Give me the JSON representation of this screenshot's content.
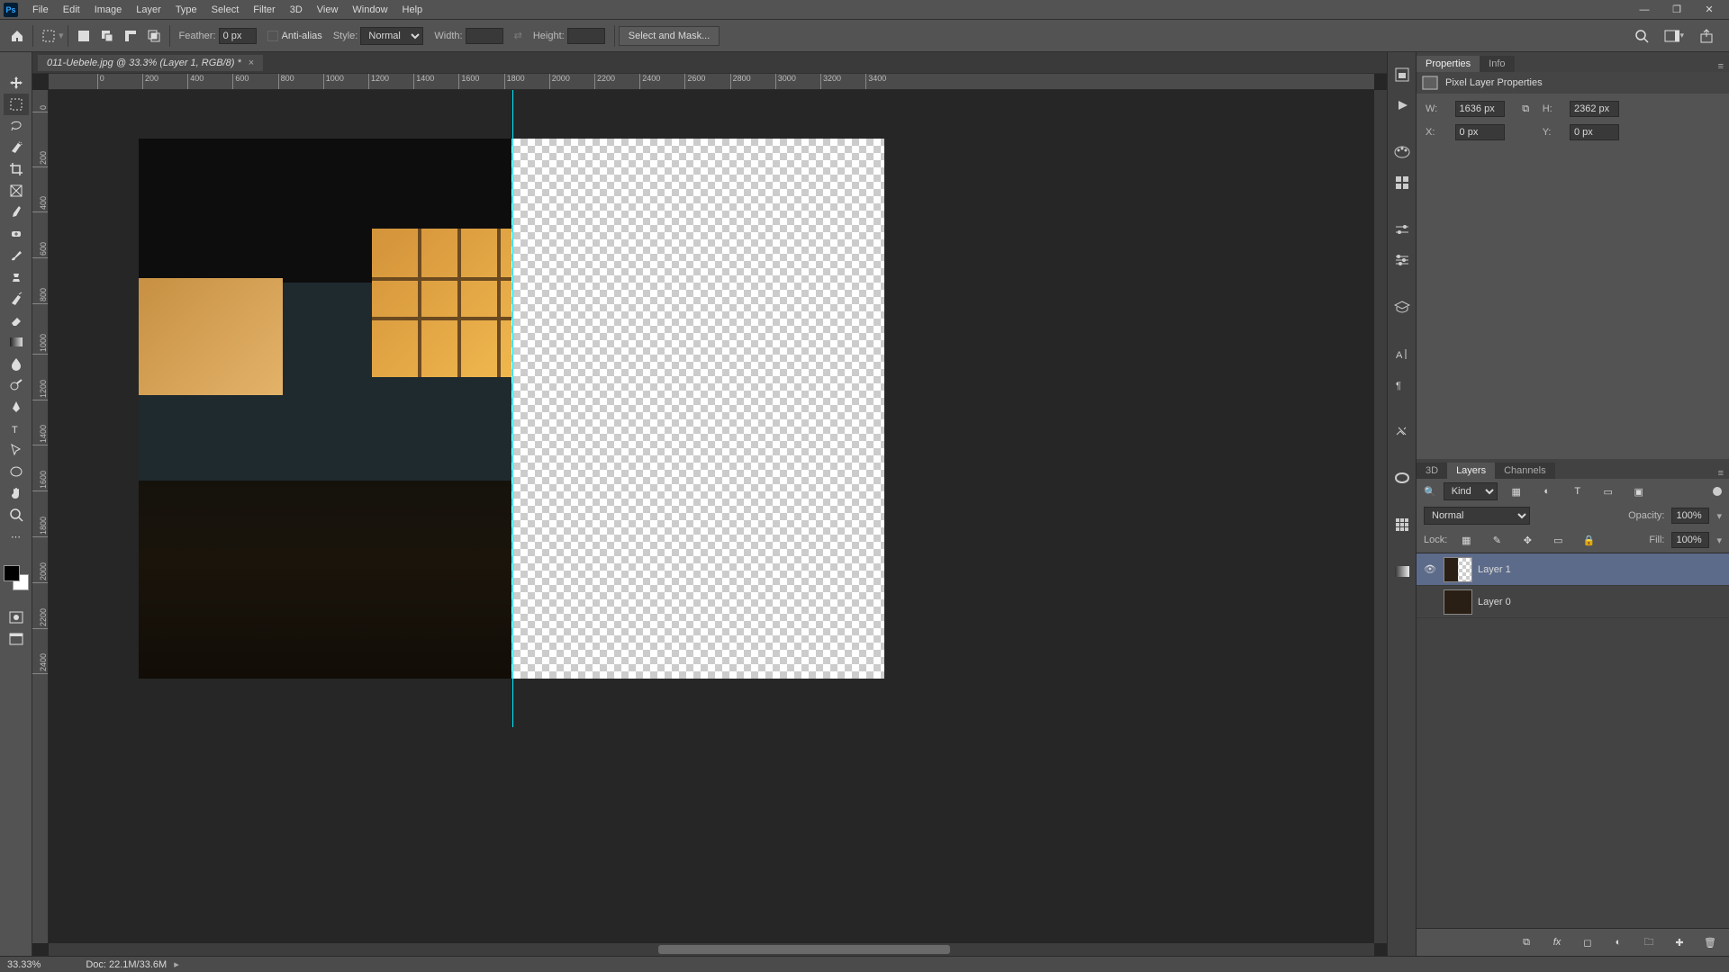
{
  "menubar": [
    "File",
    "Edit",
    "Image",
    "Layer",
    "Type",
    "Select",
    "Filter",
    "3D",
    "View",
    "Window",
    "Help"
  ],
  "optionsBar": {
    "featherLabel": "Feather:",
    "featherValue": "0 px",
    "antiAliasLabel": "Anti-alias",
    "styleLabel": "Style:",
    "styleValue": "Normal",
    "widthLabel": "Width:",
    "widthValue": "",
    "heightLabel": "Height:",
    "heightValue": "",
    "selectAndMask": "Select and Mask..."
  },
  "document": {
    "tabTitle": "011-Uebele.jpg @ 33.3% (Layer 1, RGB/8) *"
  },
  "ruler": {
    "hTicks": [
      "0",
      "200",
      "400",
      "600",
      "800",
      "1000",
      "1200",
      "1400",
      "1600",
      "1800",
      "2000",
      "2200",
      "2400",
      "2600",
      "2800",
      "3000",
      "3200",
      "3400"
    ],
    "vTicks": [
      "200",
      "0",
      "200",
      "400",
      "600",
      "800",
      "1000",
      "1200",
      "1400",
      "1600",
      "1800",
      "2000",
      "2200",
      "2400"
    ],
    "hStart": 104,
    "hStep": 50.2,
    "vStart": -34,
    "vStep": 50.8
  },
  "properties": {
    "tabs": [
      "Properties",
      "Info"
    ],
    "header": "Pixel Layer Properties",
    "W_label": "W:",
    "W": "1636 px",
    "H_label": "H:",
    "H": "2362 px",
    "X_label": "X:",
    "X": "0 px",
    "Y_label": "Y:",
    "Y": "0 px"
  },
  "layersPanel": {
    "tabs": [
      "3D",
      "Layers",
      "Channels"
    ],
    "kind": "Kind",
    "blendMode": "Normal",
    "opacityLabel": "Opacity:",
    "opacity": "100%",
    "lockLabel": "Lock:",
    "fillLabel": "Fill:",
    "fill": "100%",
    "layers": [
      {
        "name": "Layer 1",
        "visible": true,
        "selected": true
      },
      {
        "name": "Layer 0",
        "visible": false,
        "selected": false
      }
    ]
  },
  "statusbar": {
    "zoom": "33.33%",
    "docInfo": "Doc: 22.1M/33.6M"
  }
}
